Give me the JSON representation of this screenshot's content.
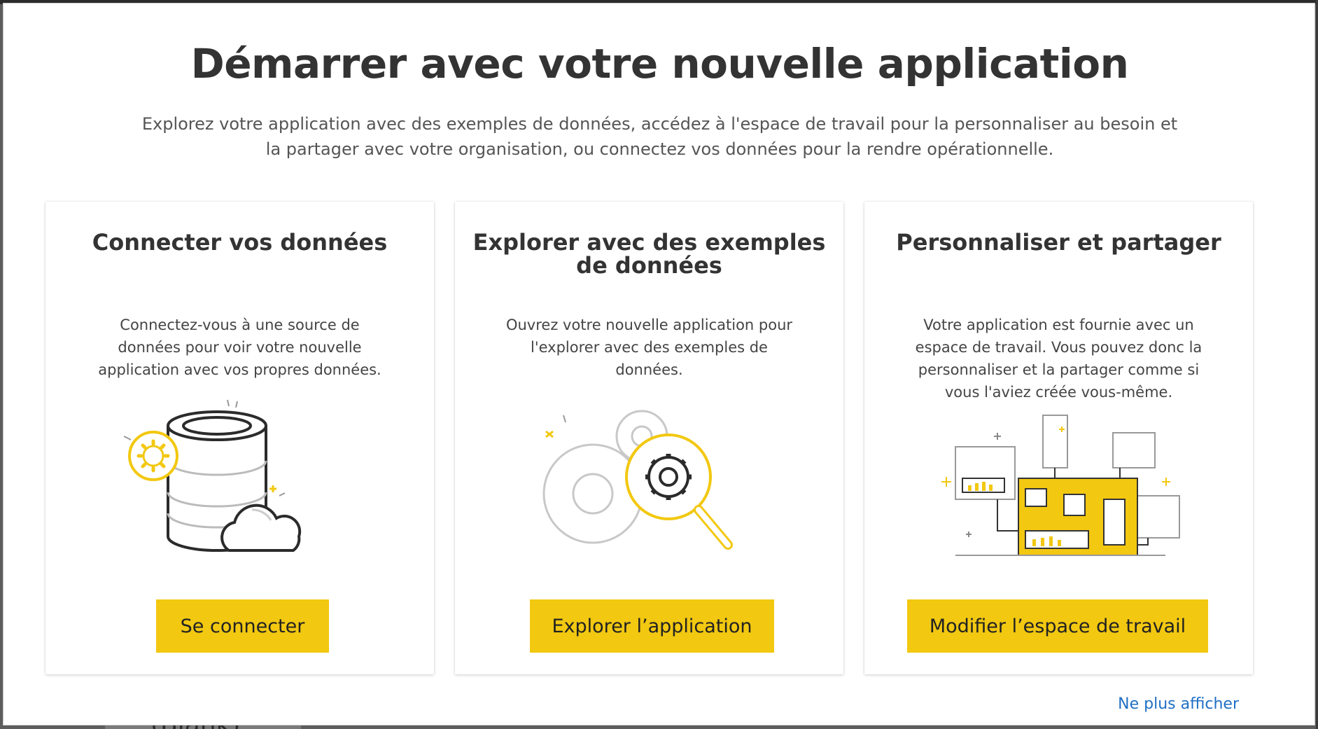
{
  "dialog": {
    "title": "Démarrer avec votre nouvelle application",
    "subtitle": "Explorez votre application avec des exemples de données, accédez à l'espace de travail pour la personnaliser au besoin et la partager avec votre organisation, ou connectez vos données pour la rendre opérationnelle.",
    "footer_link": "Ne plus afficher"
  },
  "cards": [
    {
      "title": "Connecter vos données",
      "description": "Connectez-vous à une source de données pour voir votre nouvelle application avec vos propres données.",
      "button_label": "Se connecter",
      "illustration": "database-cloud-gear-icon"
    },
    {
      "title": "Explorer avec des exemples de données",
      "description": "Ouvrez votre nouvelle application pour l'explorer avec des exemples de données.",
      "button_label": "Explorer l’application",
      "illustration": "gears-magnifier-icon"
    },
    {
      "title": "Personnaliser et partager",
      "description": "Votre application est fournie avec un espace de travail. Vous pouvez donc la personnaliser et la partager comme si vous l'aviez créée vous-même.",
      "button_label": "Modifier l’espace de travail",
      "illustration": "dashboard-network-icon"
    }
  ],
  "background": {
    "partial_text": "(Blank)"
  },
  "colors": {
    "accent": "#f2c811",
    "link": "#1f6fc4",
    "title_text": "#333333"
  }
}
